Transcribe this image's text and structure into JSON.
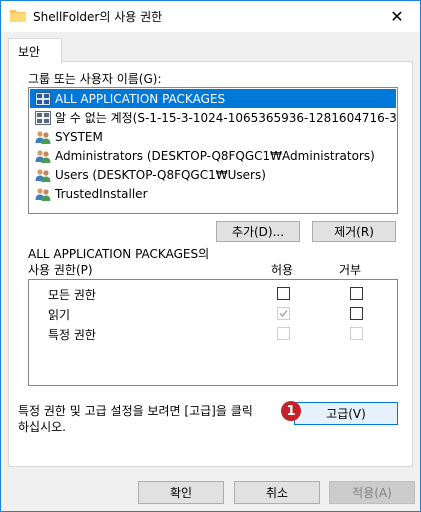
{
  "window": {
    "title": "ShellFolder의 사용 권한",
    "close_label": "✕"
  },
  "tab": {
    "label": "보안"
  },
  "group_label": "그룹 또는 사용자 이름(G):",
  "principals": [
    {
      "name": "ALL APPLICATION PACKAGES",
      "icon": "app-packages-icon",
      "selected": true
    },
    {
      "name": "알 수 없는 계정(S-1-15-3-1024-1065365936-1281604716-3...",
      "icon": "unknown-account-icon",
      "selected": false
    },
    {
      "name": "SYSTEM",
      "icon": "users-icon",
      "selected": false
    },
    {
      "name": "Administrators (DESKTOP-Q8FQGC1₩Administrators)",
      "icon": "users-icon",
      "selected": false
    },
    {
      "name": "Users (DESKTOP-Q8FQGC1₩Users)",
      "icon": "users-icon",
      "selected": false
    },
    {
      "name": "TrustedInstaller",
      "icon": "users-icon",
      "selected": false
    }
  ],
  "buttons": {
    "add": "추가(D)...",
    "remove": "제거(R)",
    "advanced": "고급(V)",
    "ok": "확인",
    "cancel": "취소",
    "apply": "적용(A)"
  },
  "perm_header": {
    "line1": "ALL APPLICATION PACKAGES의",
    "line2": "사용 권한(P)",
    "allow": "허용",
    "deny": "거부"
  },
  "permissions": [
    {
      "name": "모든 권한",
      "allow": false,
      "deny": false,
      "allow_disabled": false,
      "deny_disabled": false
    },
    {
      "name": "읽기",
      "allow": true,
      "deny": false,
      "allow_disabled": true,
      "deny_disabled": false
    },
    {
      "name": "특정 권한",
      "allow": false,
      "deny": false,
      "allow_disabled": true,
      "deny_disabled": true
    }
  ],
  "advanced_text": {
    "line1": "특정 권한 및 고급 설정을 보려면 [고급]을 클릭",
    "line2": "하십시오."
  },
  "annotation": {
    "number": "1"
  }
}
